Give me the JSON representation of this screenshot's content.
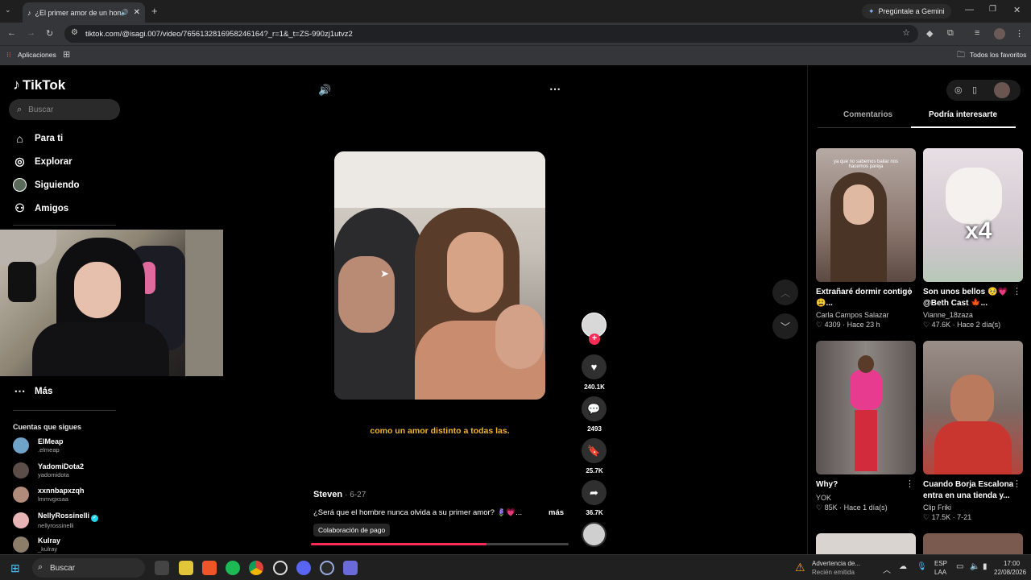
{
  "browser": {
    "tab_title": "¿El primer amor de un hom",
    "url": "tiktok.com/@isagi.007/video/7656132816958246164?_r=1&_t=ZS-990zj1utvz2",
    "gemini_label": "Pregúntale a Gemini",
    "apps_label": "Aplicaciones",
    "favorites_label": "Todos los favoritos"
  },
  "sidebar": {
    "logo": "TikTok",
    "search_placeholder": "Buscar",
    "nav": [
      "Para ti",
      "Explorar",
      "Siguiendo",
      "Amigos"
    ],
    "more": "Más",
    "following_title": "Cuentas que sigues",
    "accounts": [
      {
        "name": "ElMeap",
        "handle": ".elmeap"
      },
      {
        "name": "YadomiDota2",
        "handle": "yadomidota"
      },
      {
        "name": "xxnnbapxzqh",
        "handle": "lmmvgxsaa"
      },
      {
        "name": "NellyRossinelli",
        "handle": "nellyrossinelli"
      },
      {
        "name": "Kulray",
        "handle": "_kulray"
      }
    ]
  },
  "video": {
    "caption": "como un amor distinto a todas las.",
    "author": "Steven",
    "date": "· 6-27",
    "description": "¿Será que el hombre nunca olvida a su primer amor? 🪻💗...",
    "more": "más",
    "paid": "Colaboración de pago",
    "progress": 0.68,
    "likes": "240.1K",
    "comments": "2493",
    "saves": "25.7K",
    "shares": "36.7K"
  },
  "right_panel": {
    "tab_comments": "Comentarios",
    "tab_interest": "Podría interesarte",
    "cards": [
      {
        "title": "Extrañaré dormir contigo 😩...",
        "user": "Carla Campos Salazar",
        "stats": "♡ 4309 · Hace 23 h",
        "overlay": "ya que no sabemos bailar nos hacemos pareja"
      },
      {
        "title": "Son unos bellos 🥺💗 @Beth Cast 🍁...",
        "user": "Vianne_18zaza",
        "stats": "♡ 47.6K · Hace 2 día(s)",
        "overlay": "x4"
      },
      {
        "title": "Why?",
        "user": "YOK",
        "stats": "♡ 85K · Hace 1 día(s)",
        "overlay": ""
      },
      {
        "title": "Cuando Borja Escalona entra en una tienda y...",
        "user": "Clip Friki",
        "stats": "♡ 17.5K · 7-21",
        "overlay": ""
      }
    ]
  },
  "taskbar": {
    "search": "Buscar",
    "warning_title": "Advertencia de...",
    "warning_sub": "Recién emitida",
    "lang1": "ESP",
    "lang2": "LAA",
    "time": "17:00",
    "date": "22/08/2026"
  }
}
